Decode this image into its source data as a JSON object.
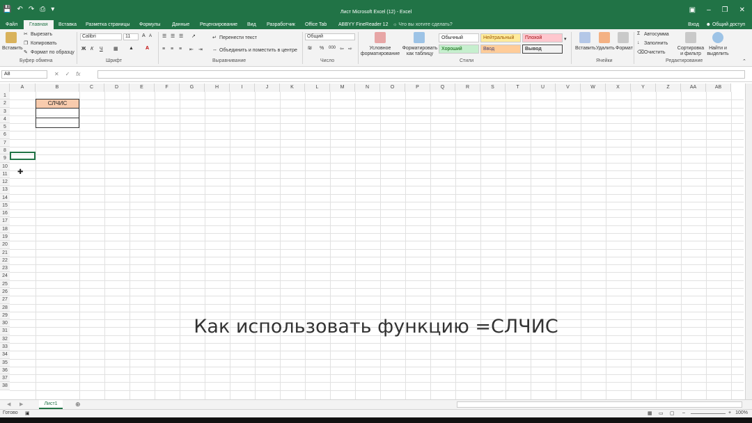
{
  "title_bar": {
    "window_title": "Лист Microsoft Excel (12) - Excel",
    "qat_icons": [
      "save-icon",
      "undo-icon",
      "redo-icon",
      "print-preview-icon",
      "customize-icon"
    ],
    "window_controls": [
      "ribbon-options-icon",
      "minimize-icon",
      "restore-icon",
      "close-icon"
    ]
  },
  "tabs": [
    {
      "label": "Файл"
    },
    {
      "label": "Главная",
      "active": true
    },
    {
      "label": "Вставка"
    },
    {
      "label": "Разметка страницы"
    },
    {
      "label": "Формулы"
    },
    {
      "label": "Данные"
    },
    {
      "label": "Рецензирование"
    },
    {
      "label": "Вид"
    },
    {
      "label": "Разработчик"
    },
    {
      "label": "Office Tab"
    },
    {
      "label": "ABBYY FineReader 12"
    }
  ],
  "tell_me": "Что вы хотите сделать?",
  "sign_in": "Вход",
  "share": "Общий доступ",
  "ribbon": {
    "clipboard": {
      "paste": "Вставить",
      "cut": "Вырезать",
      "copy": "Копировать",
      "format_painter": "Формат по образцу",
      "label": "Буфер обмена"
    },
    "font": {
      "name": "Calibri",
      "size": "11",
      "bold": "Ж",
      "italic": "К",
      "underline": "Ч",
      "grow": "A",
      "shrink": "A",
      "font_color": "A",
      "label": "Шрифт",
      "accent_color": "#ff0000",
      "fill_color": "#ffff00"
    },
    "alignment": {
      "wrap": "Перенести текст",
      "merge": "Объединить и поместить в центре",
      "label": "Выравнивание"
    },
    "number": {
      "format": "Общий",
      "percent": "%",
      "thousands": "000",
      "label": "Число"
    },
    "styles": {
      "conditional": "Условное форматирование",
      "as_table": "Форматировать как таблицу",
      "label": "Стили",
      "gallery": [
        {
          "name": "Обычный",
          "bg": "#ffffff",
          "fg": "#000000"
        },
        {
          "name": "Нейтральный",
          "bg": "#ffeb9c",
          "fg": "#9c5700"
        },
        {
          "name": "Плохой",
          "bg": "#ffc7ce",
          "fg": "#9c0006"
        },
        {
          "name": "Хороший",
          "bg": "#c6efce",
          "fg": "#006100"
        },
        {
          "name": "Ввод",
          "bg": "#ffcc99",
          "fg": "#3f3f76"
        },
        {
          "name": "Вывод",
          "bg": "#f2f2f2",
          "fg": "#3f3f3f"
        }
      ]
    },
    "cells": {
      "insert": "Вставить",
      "delete": "Удалить",
      "format": "Формат",
      "label": "Ячейки"
    },
    "editing": {
      "autosum": "Автосумма",
      "fill": "Заполнить",
      "clear": "Очистить",
      "sort": "Сортировка и фильтр",
      "find": "Найти и выделить",
      "label": "Редактирование"
    }
  },
  "formula_bar": {
    "name_box": "A8",
    "cancel": "✕",
    "enter": "✓",
    "fx": "fx",
    "value": ""
  },
  "columns": [
    "A",
    "B",
    "C",
    "D",
    "E",
    "F",
    "G",
    "H",
    "I",
    "J",
    "K",
    "L",
    "M",
    "N",
    "O",
    "P",
    "Q",
    "R",
    "S",
    "T",
    "U",
    "V",
    "W",
    "X",
    "Y",
    "Z",
    "AA",
    "AB"
  ],
  "rows": [
    "1",
    "2",
    "3",
    "4",
    "5",
    "6",
    "7",
    "8",
    "9",
    "10",
    "11",
    "12",
    "13",
    "14",
    "15",
    "16",
    "17",
    "18",
    "19",
    "20",
    "21",
    "22",
    "23",
    "24",
    "25",
    "26",
    "27",
    "28",
    "29",
    "30",
    "31",
    "32",
    "33",
    "34",
    "35",
    "36",
    "37",
    "38"
  ],
  "cells": {
    "B2": "СЛЧИС",
    "B2_fill": "#f8cbad"
  },
  "caption": "Как использовать функцию =СЛЧИС",
  "sheets": [
    {
      "name": "Лист1",
      "active": true
    }
  ],
  "status": {
    "ready": "Готово",
    "zoom": "100%"
  },
  "accent": "#217346"
}
